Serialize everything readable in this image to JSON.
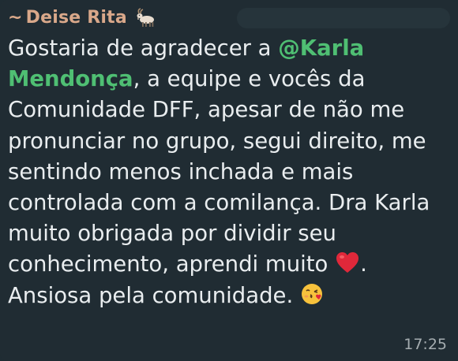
{
  "sender": {
    "prefix": "~",
    "name": "Deise Rita",
    "emoji_icon": "goat-icon",
    "name_color": "#d9a88a"
  },
  "message": {
    "part1": "Gostaria de agradecer a ",
    "mention": "@Karla Mendonça",
    "part2": ", a equipe e vocês da Comunidade DFF, apesar de não me pronunciar no grupo, segui direito, me sentindo menos inchada e mais controlada com a comilança. Dra Karla muito obrigada por dividir seu conhecimento, aprendi muito ",
    "heart_icon": "red-heart-icon",
    "part3": ". Ansiosa pela comunidade. ",
    "kiss_icon": "face-blowing-kiss-icon",
    "mention_color": "#4fbf73",
    "text_color": "#e9edef"
  },
  "timestamp": "17:25",
  "bubble_color": "#202c33"
}
